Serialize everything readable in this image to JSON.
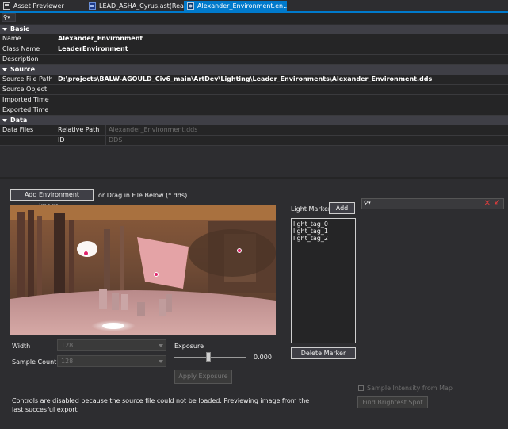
{
  "tabs": [
    {
      "label": "Asset Previewer",
      "active": false
    },
    {
      "label": "LEAD_ASHA_Cyrus.ast(Rea...",
      "active": false
    },
    {
      "label": "Alexander_Environment.en...",
      "active": true
    }
  ],
  "search": {
    "button_label": "⚲▾"
  },
  "sections": {
    "basic": "Basic",
    "source": "Source",
    "data": "Data"
  },
  "basic": [
    {
      "key": "Name",
      "value": "Alexander_Environment"
    },
    {
      "key": "Class Name",
      "value": "LeaderEnvironment"
    },
    {
      "key": "Description",
      "value": ""
    }
  ],
  "source": [
    {
      "key": "Source File Path",
      "value": "D:\\projects\\BALW-AGOULD_Civ6_main\\ArtDev\\Lighting\\Leader_Environments\\Alexander_Environment.dds"
    },
    {
      "key": "Source Object",
      "value": ""
    },
    {
      "key": "Imported Time",
      "value": ""
    },
    {
      "key": "Exported Time",
      "value": ""
    }
  ],
  "data": {
    "key": "Data Files",
    "rows": [
      {
        "k": "Relative Path",
        "v": "Alexander_Environment.dds"
      },
      {
        "k": "ID",
        "v": "DDS"
      }
    ]
  },
  "preview": {
    "add_env_button": "Add Environment Image...",
    "drag_hint": "or Drag in File Below (*.dds)",
    "width_label": "Width",
    "width_value": "128",
    "sample_count_label": "Sample Count",
    "sample_count_value": "128",
    "exposure_label": "Exposure",
    "exposure_value": "0.000",
    "apply_exposure_button": "Apply Exposure",
    "message": "Controls are disabled because the source file could not be loaded. Previewing image from the last succesful export"
  },
  "markers": {
    "title": "Light Markers",
    "add_button": "Add",
    "items": [
      "light_tag_0",
      "light_tag_1",
      "light_tag_2"
    ],
    "delete_button": "Delete Marker"
  },
  "right": {
    "search_button": "⚲▾",
    "sample_label": "Sample Intensity from Map",
    "find_button": "Find Brightest Spot"
  },
  "colors": {
    "accent": "#007acc",
    "close_red": "#e03c3c"
  }
}
